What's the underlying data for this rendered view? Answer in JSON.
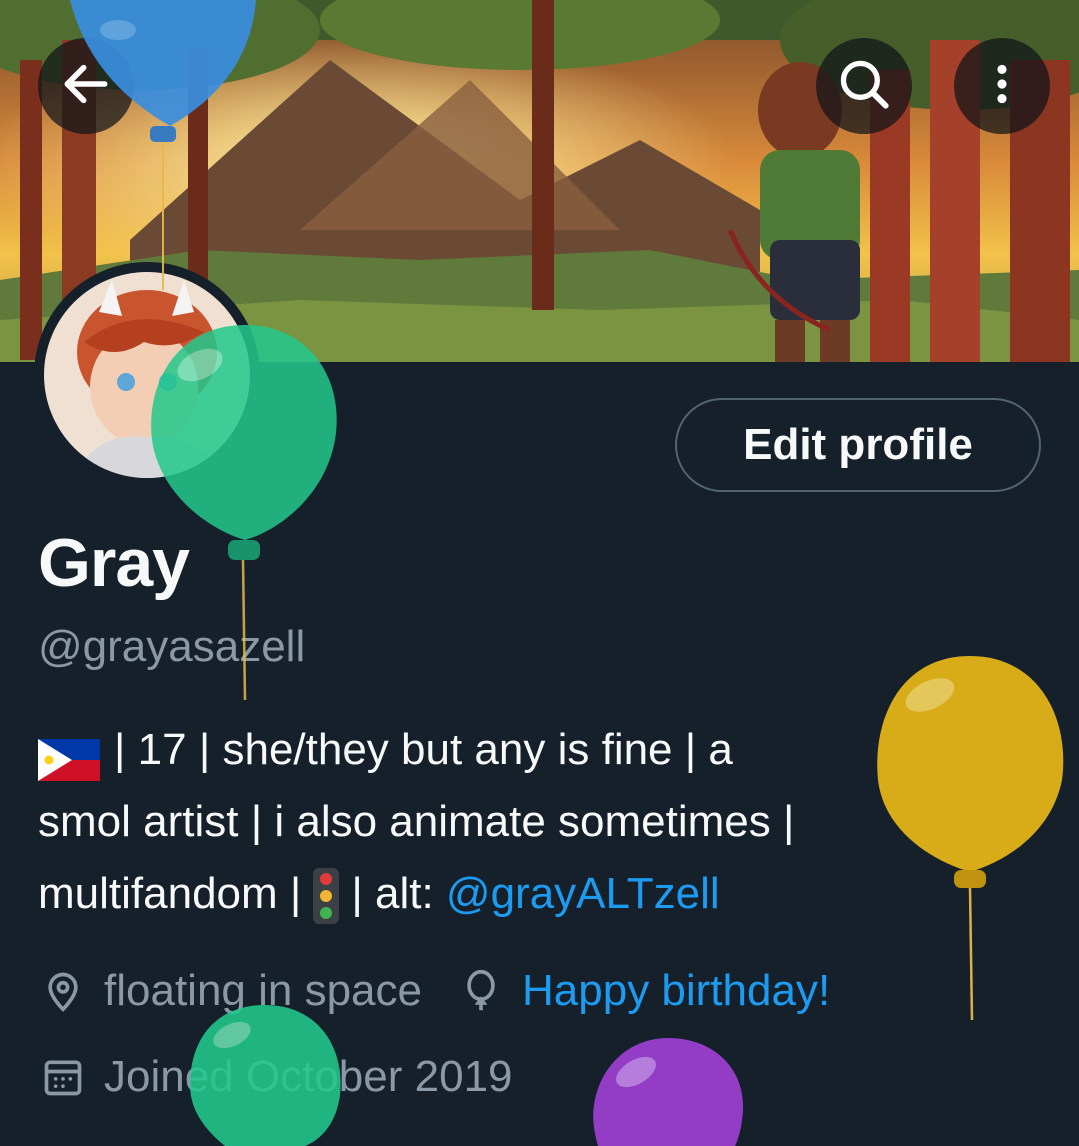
{
  "profile": {
    "name": "Gray",
    "handle": "@grayasazell",
    "edit_label": "Edit profile",
    "bio": {
      "line1_text": "| 17 | she/they but any is fine | a",
      "line2_text": "smol artist | i also animate sometimes |",
      "line3_pre": "multifandom |",
      "line3_mid": "| alt:",
      "line3_link": "@grayALTzell"
    },
    "location": "floating in space",
    "birthday": "Happy birthday!",
    "joined": "Joined October 2019"
  },
  "icons": {
    "back": "arrow-left-icon",
    "search": "search-icon",
    "more": "more-vertical-icon",
    "location": "location-pin-icon",
    "birthday": "balloon-icon",
    "joined": "calendar-icon",
    "flag": "philippines-flag-icon",
    "traffic": "traffic-light-icon"
  },
  "colors": {
    "background": "#15202b",
    "accent": "#1d9bf0",
    "secondary_text": "#8b98a5"
  }
}
